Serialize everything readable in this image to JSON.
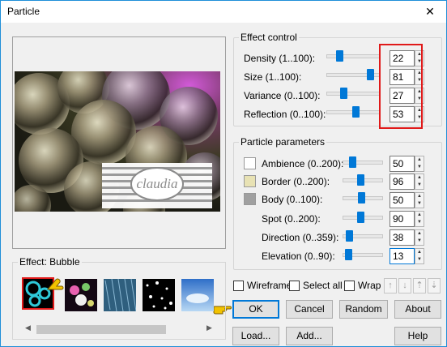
{
  "window": {
    "title": "Particle",
    "close_glyph": "✕"
  },
  "effect_control": {
    "title": "Effect control",
    "rows": [
      {
        "label": "Density (1..100):",
        "value": "22"
      },
      {
        "label": "Size (1..100):",
        "value": "81"
      },
      {
        "label": "Variance (0..100):",
        "value": "27"
      },
      {
        "label": "Reflection (0..100):",
        "value": "53"
      }
    ]
  },
  "particle_parameters": {
    "title": "Particle parameters",
    "rows": [
      {
        "label": "Ambience (0..200):",
        "value": "50",
        "swatch": "#ffffff"
      },
      {
        "label": "Border (0..200):",
        "value": "96",
        "swatch": "#e8e2b4"
      },
      {
        "label": "Body (0..100):",
        "value": "50",
        "swatch": "#a0a0a0"
      },
      {
        "label": "Spot (0..200):",
        "value": "90"
      },
      {
        "label": "Direction (0..359):",
        "value": "38"
      },
      {
        "label": "Elevation (0..90):",
        "value": "13"
      }
    ]
  },
  "effect": {
    "label": "Effect: Bubble"
  },
  "options": {
    "wireframe": "Wireframe",
    "select_all": "Select all",
    "wrap": "Wrap"
  },
  "buttons": {
    "ok": "OK",
    "cancel": "Cancel",
    "random": "Random",
    "about": "About",
    "load": "Load...",
    "add": "Add...",
    "help": "Help"
  },
  "watermark": {
    "text": "claudia"
  },
  "arrows": [
    "↑",
    "↓",
    "⇡",
    "⇣"
  ],
  "icons": {
    "hand": "hand-pointer-icon",
    "spin_up": "▲",
    "spin_down": "▼",
    "scroll_left": "◀",
    "scroll_right": "▶"
  },
  "colors": {
    "accent": "#0078d7",
    "highlight": "#e01919",
    "pointer": "#f2c200"
  }
}
